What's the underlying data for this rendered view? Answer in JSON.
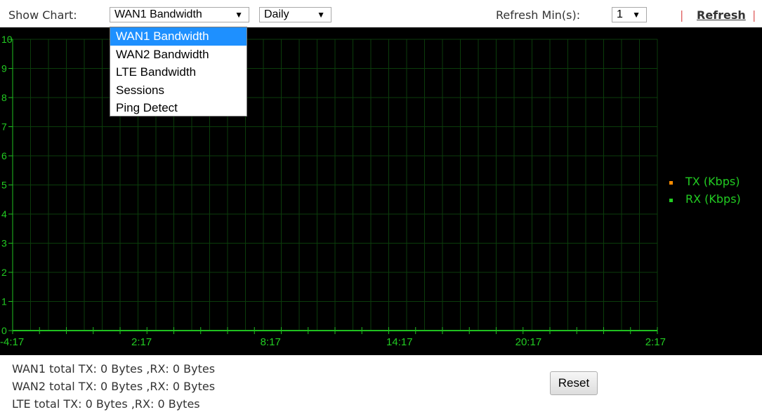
{
  "toolbar": {
    "show_chart_label": "Show Chart:",
    "chart_select_value": "WAN1 Bandwidth",
    "period_select_value": "Daily",
    "refresh_min_label": "Refresh Min(s):",
    "refresh_min_value": "1",
    "separator": "|",
    "refresh_label": "Refresh"
  },
  "dropdown": {
    "options": [
      "WAN1 Bandwidth",
      "WAN2 Bandwidth",
      "LTE Bandwidth",
      "Sessions",
      "Ping Detect"
    ],
    "selected_index": 0
  },
  "colors": {
    "chart_background": "#000000",
    "grid": "#0b3d0b",
    "axis": "#1fbf1f",
    "text_green": "#22cc22",
    "tx_marker": "#ff8c00",
    "rx_marker": "#22cc22",
    "selected_option": "#1e90ff"
  },
  "chart_data": {
    "type": "line",
    "ylim": [
      0,
      10
    ],
    "y_ticks": [
      "0",
      "1",
      "2",
      "3",
      "4",
      "5",
      "6",
      "7",
      "8",
      "9",
      "10"
    ],
    "x_tick_labels": [
      "-4:17",
      "2:17",
      "8:17",
      "14:17",
      "20:17",
      "2:17"
    ],
    "series": [
      {
        "name": "TX (Kbps)",
        "values": []
      },
      {
        "name": "RX (Kbps)",
        "values": []
      }
    ]
  },
  "stats": [
    "WAN1 total TX: 0 Bytes ,RX: 0 Bytes",
    "WAN2 total TX: 0 Bytes ,RX: 0 Bytes",
    "LTE total TX: 0 Bytes ,RX: 0 Bytes"
  ],
  "reset_label": "Reset"
}
